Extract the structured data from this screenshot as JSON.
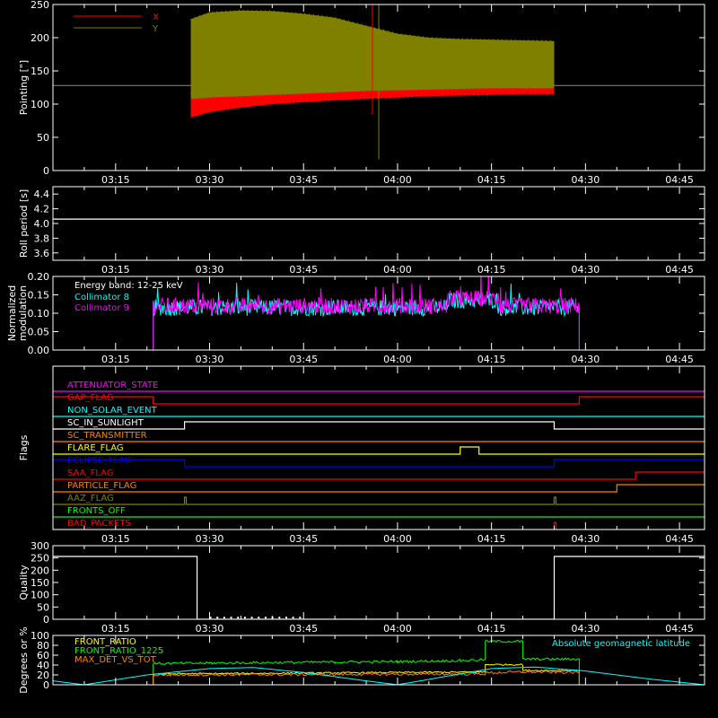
{
  "chart_data": [
    {
      "type": "line",
      "panel": "pointing",
      "ylabel": "Pointing [\"]",
      "ylim": [
        0,
        250
      ],
      "yticks": [
        0,
        50,
        100,
        150,
        200,
        250
      ],
      "xlim": [
        "03:05",
        "04:49"
      ],
      "xticks": [
        "03:15",
        "03:30",
        "03:45",
        "04:00",
        "04:15",
        "04:30",
        "04:45"
      ],
      "reference_line": 128,
      "series": [
        {
          "name": "X",
          "color": "#ff0000",
          "x": [
            "03:27",
            "03:30",
            "03:35",
            "03:40",
            "03:45",
            "03:50",
            "03:55",
            "04:00",
            "04:05",
            "04:10",
            "04:15",
            "04:20",
            "04:25"
          ],
          "low": [
            80,
            88,
            95,
            100,
            103,
            106,
            108,
            110,
            112,
            113,
            114,
            115,
            115
          ],
          "high": [
            118,
            120,
            122,
            124,
            126,
            127,
            128,
            128,
            128,
            128,
            128,
            128,
            128
          ]
        },
        {
          "name": "Y",
          "color": "#808000",
          "x": [
            "03:27",
            "03:30",
            "03:35",
            "03:40",
            "03:45",
            "03:50",
            "03:55",
            "04:00",
            "04:05",
            "04:10",
            "04:15",
            "04:20",
            "04:25"
          ],
          "low": [
            108,
            110,
            112,
            114,
            116,
            118,
            120,
            121,
            122,
            123,
            124,
            124,
            124
          ],
          "high": [
            228,
            238,
            241,
            240,
            236,
            230,
            218,
            206,
            200,
            198,
            197,
            196,
            195
          ]
        }
      ],
      "spikes": [
        {
          "x": "03:57",
          "low": 17,
          "high": 250,
          "color": "#808000"
        },
        {
          "x": "03:56",
          "low": 85,
          "high": 250,
          "color": "#ff0000"
        }
      ]
    },
    {
      "type": "line",
      "panel": "roll",
      "ylabel": "Roll period [s]",
      "ylim": [
        3.5,
        4.5
      ],
      "yticks": [
        3.6,
        3.8,
        4.0,
        4.2,
        4.4
      ],
      "xlim": [
        "03:05",
        "04:49"
      ],
      "xticks": [
        "03:15",
        "03:30",
        "03:45",
        "04:00",
        "04:15",
        "04:30",
        "04:45"
      ],
      "series": [
        {
          "name": "",
          "color": "#ffffff",
          "x": [
            "03:05",
            "04:49"
          ],
          "y": [
            4.06,
            4.06
          ]
        }
      ]
    },
    {
      "type": "line",
      "panel": "modulation",
      "ylabel": "Normalized modulation",
      "ylim": [
        0,
        0.2
      ],
      "yticks": [
        0.0,
        0.05,
        0.1,
        0.15,
        0.2
      ],
      "xlim": [
        "03:05",
        "04:49"
      ],
      "xticks": [
        "03:15",
        "03:30",
        "03:45",
        "04:00",
        "04:15",
        "04:30",
        "04:45"
      ],
      "annotation": "Energy band: 12-25 keV",
      "series": [
        {
          "name": "Collimator 8",
          "color": "#00ffff",
          "start": "03:21",
          "end": "04:29",
          "mean": 0.115
        },
        {
          "name": "Collimator 9",
          "color": "#ff00ff",
          "start": "03:21",
          "end": "04:29",
          "mean": 0.12
        }
      ]
    },
    {
      "type": "line",
      "panel": "flags",
      "ylabel": "Flags",
      "xlim": [
        "03:05",
        "04:49"
      ],
      "xticks": [
        "03:15",
        "03:30",
        "03:45",
        "04:00",
        "04:15",
        "04:30",
        "04:45"
      ],
      "flags": [
        {
          "name": "ATTENUATOR_STATE",
          "color": "#ff00ff",
          "steps": []
        },
        {
          "name": "GAP_FLAG",
          "color": "#ff0000",
          "steps": [
            [
              "03:05",
              1
            ],
            [
              "03:21",
              0
            ],
            [
              "04:29",
              1
            ]
          ]
        },
        {
          "name": "NON_SOLAR_EVENT",
          "color": "#00ffff",
          "steps": []
        },
        {
          "name": "SC_IN_SUNLIGHT",
          "color": "#ffffff",
          "steps": [
            [
              "03:05",
              0
            ],
            [
              "03:26",
              1
            ],
            [
              "04:25",
              0
            ]
          ]
        },
        {
          "name": "SC_TRANSMITTER",
          "color": "#ff8000",
          "steps": []
        },
        {
          "name": "FLARE_FLAG",
          "color": "#ffff00",
          "steps": [
            [
              "03:05",
              0
            ],
            [
              "04:10",
              1
            ],
            [
              "04:13",
              0
            ]
          ]
        },
        {
          "name": "ECLIPSE_FLAG",
          "color": "#0000ff",
          "steps": [
            [
              "03:05",
              1
            ],
            [
              "03:26",
              0
            ],
            [
              "04:25",
              1
            ]
          ]
        },
        {
          "name": "SAA_FLAG",
          "color": "#ff0000",
          "steps": [
            [
              "03:05",
              0
            ],
            [
              "04:38",
              1
            ]
          ]
        },
        {
          "name": "PARTICLE_FLAG",
          "color": "#ff8000",
          "steps": [
            [
              "03:05",
              0
            ],
            [
              "04:35",
              1
            ]
          ]
        },
        {
          "name": "AAZ_FLAG",
          "color": "#808000",
          "pulses": [
            "03:26",
            "04:25"
          ]
        },
        {
          "name": "FRONTS_OFF",
          "color": "#00ff00",
          "steps": []
        },
        {
          "name": "BAD_PACKETS",
          "color": "#ff0000",
          "pulses": [
            "04:25"
          ]
        }
      ]
    },
    {
      "type": "line",
      "panel": "quality",
      "ylabel": "Quality",
      "ylim": [
        0,
        300
      ],
      "yticks": [
        0,
        50,
        100,
        150,
        200,
        250,
        300
      ],
      "xlim": [
        "03:05",
        "04:49"
      ],
      "xticks": [
        "03:15",
        "03:30",
        "03:45",
        "04:00",
        "04:15",
        "04:30",
        "04:45"
      ],
      "series": [
        {
          "name": "",
          "color": "#ffffff",
          "x": [
            "03:05",
            "03:28",
            "03:28",
            "04:25",
            "04:25",
            "04:49"
          ],
          "y": [
            256,
            256,
            0,
            0,
            256,
            256
          ]
        }
      ]
    },
    {
      "type": "line",
      "panel": "ratios",
      "ylabel": "Degrees or %",
      "ylim": [
        0,
        100
      ],
      "yticks": [
        0,
        20,
        40,
        60,
        80,
        100
      ],
      "xlim": [
        "03:05",
        "04:49"
      ],
      "series": [
        {
          "name": "FRONT_RATIO",
          "color": "#ffff00",
          "x": [
            "03:21",
            "04:14",
            "04:14",
            "04:20",
            "04:20",
            "04:29"
          ],
          "y": [
            22,
            26,
            41,
            41,
            29,
            29
          ]
        },
        {
          "name": "FRONT_RATIO_1225",
          "color": "#00ff00",
          "x": [
            "03:21",
            "03:30",
            "03:40",
            "03:50",
            "04:00",
            "04:10",
            "04:14",
            "04:14",
            "04:20",
            "04:20",
            "04:29"
          ],
          "y": [
            43,
            44,
            45,
            46,
            47,
            49,
            51,
            88,
            88,
            52,
            52
          ]
        },
        {
          "name": "MAX_DET_VS_TOT",
          "color": "#ff8000",
          "x": [
            "03:21",
            "04:14",
            "04:14",
            "04:20",
            "04:29"
          ],
          "y": [
            20,
            22,
            24,
            26,
            25
          ]
        },
        {
          "name": "Absolute geomagnetic latitude",
          "color": "#00ffff",
          "x": [
            "03:05",
            "03:10",
            "03:20",
            "03:30",
            "03:37",
            "03:45",
            "03:55",
            "04:00",
            "04:10",
            "04:15",
            "04:22",
            "04:30",
            "04:40",
            "04:49"
          ],
          "y": [
            8,
            0,
            20,
            33,
            35,
            25,
            8,
            0,
            22,
            33,
            36,
            28,
            12,
            0
          ]
        }
      ]
    }
  ]
}
